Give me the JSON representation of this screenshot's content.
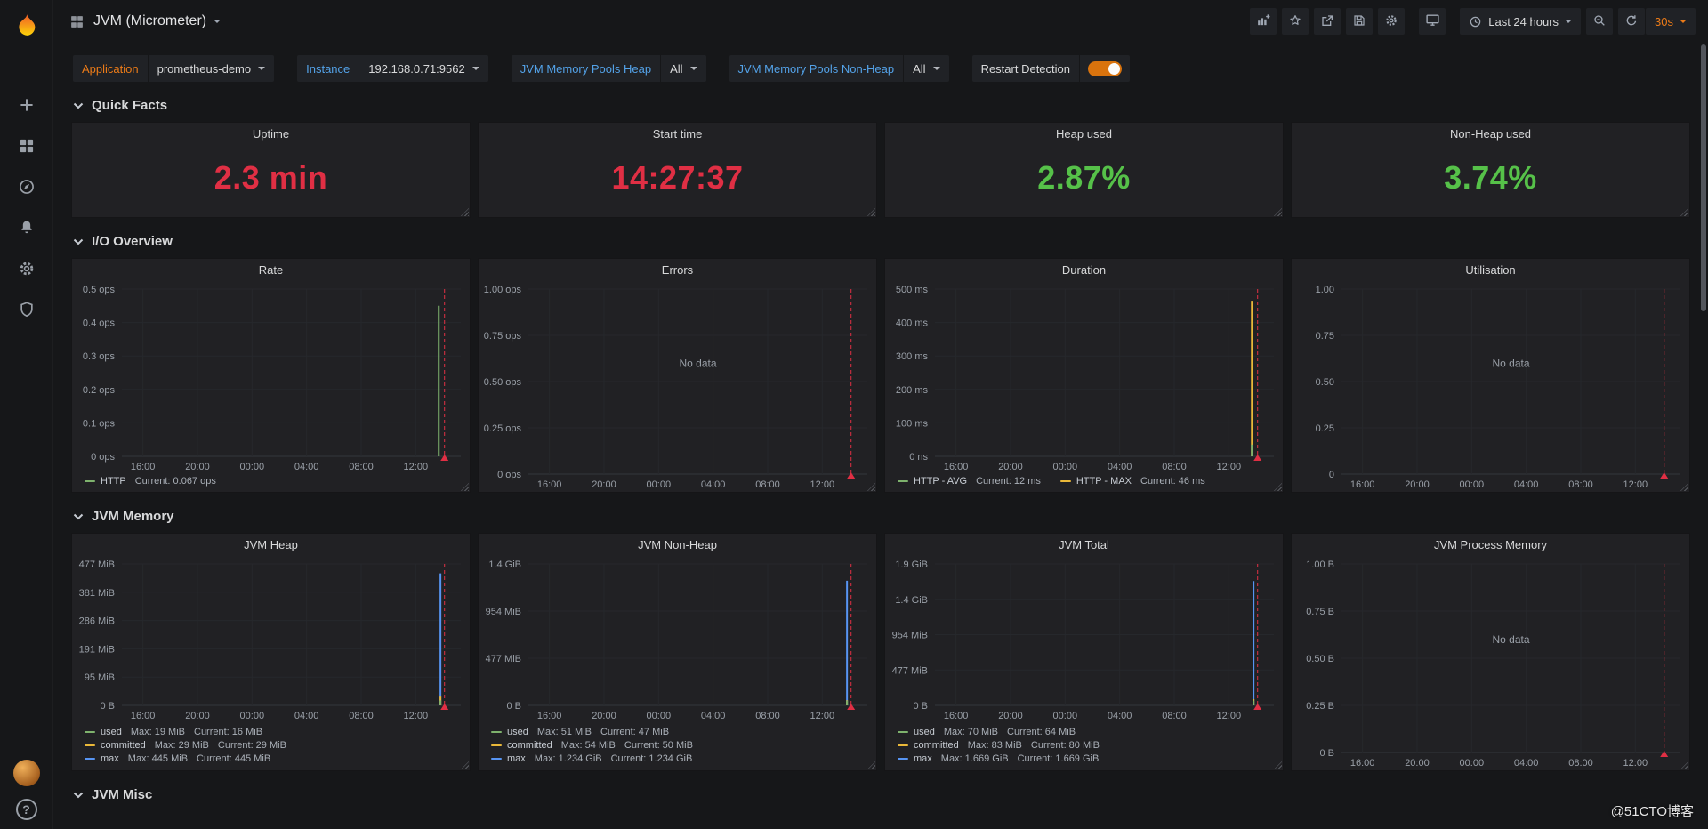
{
  "strings": {
    "no_data": "No data"
  },
  "watermark": "@51CTO博客",
  "navbar": {
    "title": "JVM (Micrometer)",
    "time_range": "Last 24 hours",
    "refresh_interval": "30s"
  },
  "sidebar": {
    "help_glyph": "?"
  },
  "icons": {
    "grafana-logo": "orange flame",
    "plus-icon": "+",
    "apps-icon": "▦",
    "compass-icon": "explore compass",
    "bell-icon": "alerting bell",
    "gear-icon": "⚙",
    "shield-icon": "admin shield",
    "add-panel-icon": "bar chart with plus",
    "star-icon": "☆",
    "share-icon": "box with arrow",
    "save-icon": "floppy disk",
    "monitor-icon": "display / cycle view",
    "clock-icon": "clock",
    "zoom-out-icon": "magnifier with minus",
    "refresh-icon": "⟳",
    "caret-down-icon": "▾",
    "chevron-down-icon": "⌄",
    "help-icon": "?"
  },
  "filters": {
    "application": {
      "label": "Application",
      "value": "prometheus-demo",
      "label_color": "#eb7b18"
    },
    "instance": {
      "label": "Instance",
      "value": "192.168.0.71:9562",
      "label_color": "#53a2e8"
    },
    "heap_pools": {
      "label": "JVM Memory Pools Heap",
      "value": "All",
      "label_color": "#53a2e8"
    },
    "nonheap_pools": {
      "label": "JVM Memory Pools Non-Heap",
      "value": "All",
      "label_color": "#53a2e8"
    },
    "restart_detection": {
      "label": "Restart Detection",
      "enabled": true,
      "on_color": "#d9730d"
    }
  },
  "sections": [
    {
      "title": "Quick Facts"
    },
    {
      "title": "I/O Overview"
    },
    {
      "title": "JVM Memory"
    },
    {
      "title": "JVM Misc"
    }
  ],
  "quick_facts": [
    {
      "title": "Uptime",
      "value": "2.3 min",
      "color": "#e02f44"
    },
    {
      "title": "Start time",
      "value": "14:27:37",
      "color": "#e02f44"
    },
    {
      "title": "Heap used",
      "value": "2.87%",
      "color": "#56c149"
    },
    {
      "title": "Non-Heap used",
      "value": "3.74%",
      "color": "#56c149"
    }
  ],
  "chart_defaults": {
    "x_tick_fractions": [
      0.062,
      0.223,
      0.384,
      0.545,
      0.706,
      0.867
    ],
    "annotation_color": "#e02f44",
    "grid": true,
    "legend_position": "bottom"
  },
  "chart_data": [
    {
      "panel": "Rate",
      "row": "io",
      "type": "line",
      "unit": "ops",
      "x_ticks": [
        "16:00",
        "20:00",
        "00:00",
        "04:00",
        "08:00",
        "12:00"
      ],
      "y_ticks": [
        "0 ops",
        "0.1 ops",
        "0.2 ops",
        "0.3 ops",
        "0.4 ops",
        "0.5 ops"
      ],
      "ylim": [
        0,
        0.5
      ],
      "no_data": false,
      "legend_rows": false,
      "series": [
        {
          "name": "HTTP",
          "color": "#7eb26d",
          "current": "0.067 ops"
        }
      ],
      "spikes": [
        {
          "color": "#7eb26d",
          "x": 0.935,
          "peak": 0.9
        }
      ],
      "annotation_x": 0.952
    },
    {
      "panel": "Errors",
      "row": "io",
      "type": "line",
      "unit": "ops",
      "x_ticks": [
        "16:00",
        "20:00",
        "00:00",
        "04:00",
        "08:00",
        "12:00"
      ],
      "y_ticks": [
        "0 ops",
        "0.25 ops",
        "0.50 ops",
        "0.75 ops",
        "1.00 ops"
      ],
      "ylim": [
        0,
        1
      ],
      "no_data": true,
      "legend_rows": false,
      "series": [],
      "spikes": [],
      "annotation_x": 0.952
    },
    {
      "panel": "Duration",
      "row": "io",
      "type": "line",
      "unit": "ms",
      "x_ticks": [
        "16:00",
        "20:00",
        "00:00",
        "04:00",
        "08:00",
        "12:00"
      ],
      "y_ticks": [
        "0 ns",
        "100 ms",
        "200 ms",
        "300 ms",
        "400 ms",
        "500 ms"
      ],
      "ylim": [
        0,
        500
      ],
      "no_data": false,
      "legend_rows": false,
      "series": [
        {
          "name": "HTTP - AVG",
          "color": "#7eb26d",
          "current": "12 ms"
        },
        {
          "name": "HTTP - MAX",
          "color": "#eab839",
          "current": "46 ms"
        }
      ],
      "spikes": [
        {
          "color": "#eab839",
          "x": 0.935,
          "peak": 0.93
        },
        {
          "color": "#7eb26d",
          "x": 0.935,
          "peak": 0.07
        }
      ],
      "annotation_x": 0.952
    },
    {
      "panel": "Utilisation",
      "row": "io",
      "type": "line",
      "unit": "",
      "x_ticks": [
        "16:00",
        "20:00",
        "00:00",
        "04:00",
        "08:00",
        "12:00"
      ],
      "y_ticks": [
        "0",
        "0.25",
        "0.50",
        "0.75",
        "1.00"
      ],
      "ylim": [
        0,
        1
      ],
      "no_data": true,
      "legend_rows": false,
      "series": [],
      "spikes": [],
      "annotation_x": 0.952
    },
    {
      "panel": "JVM Heap",
      "row": "mem",
      "type": "line",
      "unit": "bytes",
      "x_ticks": [
        "16:00",
        "20:00",
        "00:00",
        "04:00",
        "08:00",
        "12:00"
      ],
      "y_ticks": [
        "0 B",
        "95 MiB",
        "191 MiB",
        "286 MiB",
        "381 MiB",
        "477 MiB"
      ],
      "ylim": [
        0,
        477
      ],
      "no_data": false,
      "legend_rows": true,
      "series": [
        {
          "name": "used",
          "color": "#7eb26d",
          "max": "19 MiB",
          "current": "16 MiB"
        },
        {
          "name": "committed",
          "color": "#eab839",
          "max": "29 MiB",
          "current": "29 MiB"
        },
        {
          "name": "max",
          "color": "#5794f2",
          "max": "445 MiB",
          "current": "445 MiB"
        }
      ],
      "spikes": [
        {
          "color": "#5794f2",
          "x": 0.94,
          "peak": 0.933
        },
        {
          "color": "#eab839",
          "x": 0.94,
          "peak": 0.062
        },
        {
          "color": "#7eb26d",
          "x": 0.94,
          "peak": 0.035
        }
      ],
      "annotation_x": 0.952
    },
    {
      "panel": "JVM Non-Heap",
      "row": "mem",
      "type": "line",
      "unit": "bytes",
      "x_ticks": [
        "16:00",
        "20:00",
        "00:00",
        "04:00",
        "08:00",
        "12:00"
      ],
      "y_ticks": [
        "0 B",
        "477 MiB",
        "954 MiB",
        "1.4 GiB"
      ],
      "ylim": [
        0,
        1.4
      ],
      "no_data": false,
      "legend_rows": true,
      "series": [
        {
          "name": "used",
          "color": "#7eb26d",
          "max": "51 MiB",
          "current": "47 MiB"
        },
        {
          "name": "committed",
          "color": "#eab839",
          "max": "54 MiB",
          "current": "50 MiB"
        },
        {
          "name": "max",
          "color": "#5794f2",
          "max": "1.234 GiB",
          "current": "1.234 GiB"
        }
      ],
      "spikes": [
        {
          "color": "#5794f2",
          "x": 0.94,
          "peak": 0.881
        },
        {
          "color": "#eab839",
          "x": 0.94,
          "peak": 0.036
        },
        {
          "color": "#7eb26d",
          "x": 0.94,
          "peak": 0.033
        }
      ],
      "annotation_x": 0.952
    },
    {
      "panel": "JVM Total",
      "row": "mem",
      "type": "line",
      "unit": "bytes",
      "x_ticks": [
        "16:00",
        "20:00",
        "00:00",
        "04:00",
        "08:00",
        "12:00"
      ],
      "y_ticks": [
        "0 B",
        "477 MiB",
        "954 MiB",
        "1.4 GiB",
        "1.9 GiB"
      ],
      "ylim": [
        0,
        1.9
      ],
      "no_data": false,
      "legend_rows": true,
      "series": [
        {
          "name": "used",
          "color": "#7eb26d",
          "max": "70 MiB",
          "current": "64 MiB"
        },
        {
          "name": "committed",
          "color": "#eab839",
          "max": "83 MiB",
          "current": "80 MiB"
        },
        {
          "name": "max",
          "color": "#5794f2",
          "max": "1.669 GiB",
          "current": "1.669 GiB"
        }
      ],
      "spikes": [
        {
          "color": "#5794f2",
          "x": 0.94,
          "peak": 0.879
        },
        {
          "color": "#eab839",
          "x": 0.94,
          "peak": 0.044
        },
        {
          "color": "#7eb26d",
          "x": 0.94,
          "peak": 0.034
        }
      ],
      "annotation_x": 0.952
    },
    {
      "panel": "JVM Process Memory",
      "row": "mem",
      "type": "line",
      "unit": "bytes",
      "x_ticks": [
        "16:00",
        "20:00",
        "00:00",
        "04:00",
        "08:00",
        "12:00"
      ],
      "y_ticks": [
        "0 B",
        "0.25 B",
        "0.50 B",
        "0.75 B",
        "1.00 B"
      ],
      "ylim": [
        0,
        1
      ],
      "no_data": true,
      "legend_rows": false,
      "series": [],
      "spikes": [],
      "annotation_x": 0.952
    }
  ]
}
